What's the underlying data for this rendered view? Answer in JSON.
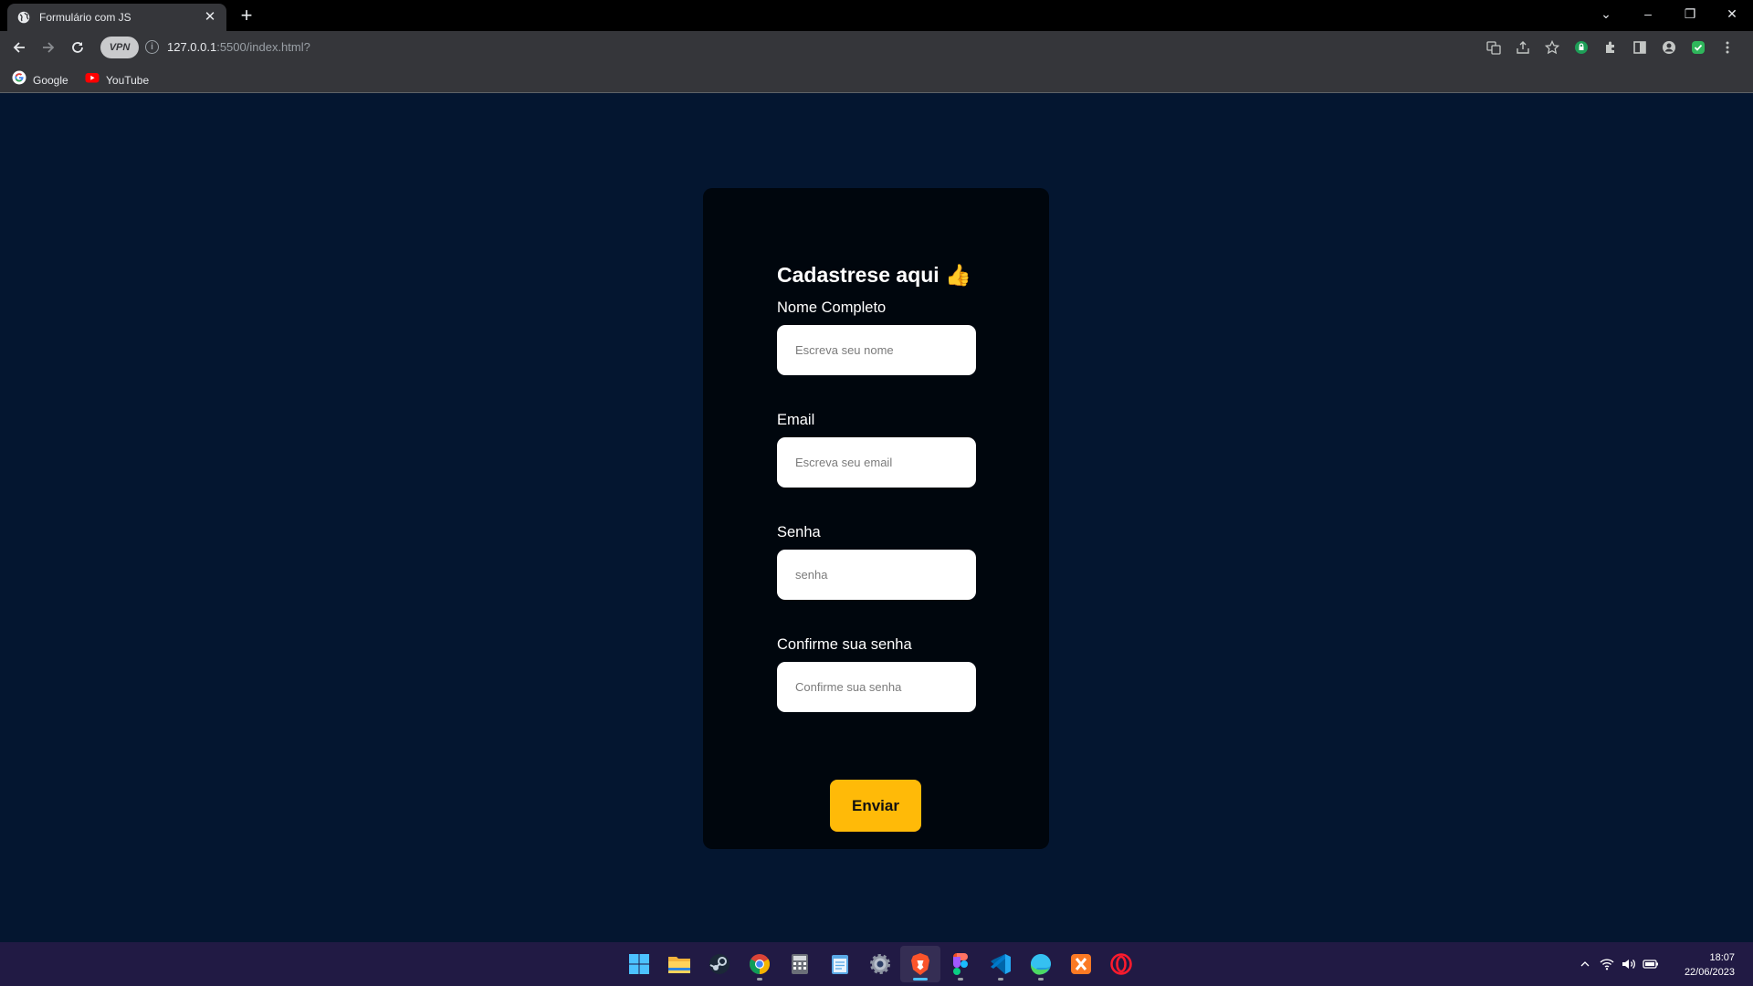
{
  "browser": {
    "tab_title": "Formulário com JS",
    "url_host": "127.0.0.1",
    "url_rest": ":5500/index.html?",
    "vpn_label": "VPN",
    "bookmarks": [
      {
        "label": "Google",
        "icon": "google-icon"
      },
      {
        "label": "YouTube",
        "icon": "youtube-icon"
      }
    ]
  },
  "form": {
    "title": "Cadastrese aqui 👍",
    "fields": [
      {
        "label": "Nome Completo",
        "placeholder": "Escreva seu nome"
      },
      {
        "label": "Email",
        "placeholder": "Escreva seu email"
      },
      {
        "label": "Senha",
        "placeholder": "senha"
      },
      {
        "label": "Confirme sua senha",
        "placeholder": "Confirme sua senha"
      }
    ],
    "submit_label": "Enviar"
  },
  "colors": {
    "page_bg": "#041630",
    "card_bg": "#00060d",
    "button_bg": "#ffba08"
  },
  "taskbar": {
    "apps": [
      "start-icon",
      "file-explorer-icon",
      "steam-icon",
      "chrome-icon",
      "calculator-icon",
      "notepad-icon",
      "settings-icon",
      "brave-icon",
      "figma-icon",
      "vscode-icon",
      "edge-icon",
      "xampp-icon",
      "opera-icon"
    ],
    "time": "18:07",
    "date": "22/06/2023"
  }
}
